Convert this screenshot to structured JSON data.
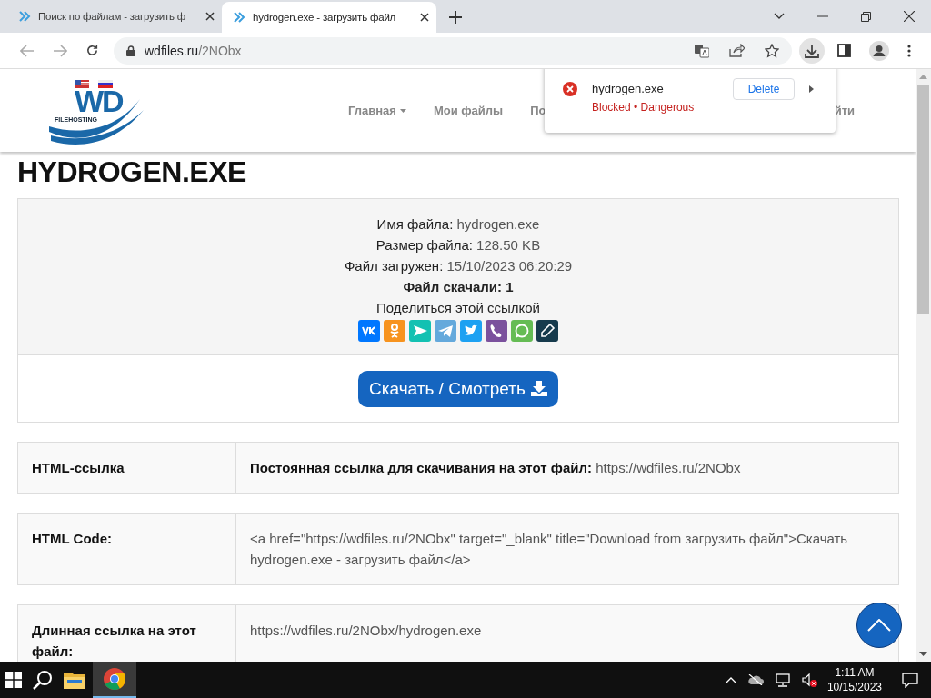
{
  "browser": {
    "tabs": [
      {
        "title": "Поиск по файлам - загрузить ф",
        "selected": false
      },
      {
        "title": "hydrogen.exe - загрузить файл",
        "selected": true
      }
    ],
    "url_host": "wdfiles.ru",
    "url_path": "/2NObx"
  },
  "download_popup": {
    "file": "hydrogen.exe",
    "status": "Blocked • Dangerous",
    "button": "Delete"
  },
  "site": {
    "logo": "WD",
    "logo_subtitle": "FILEHOSTING",
    "nav": [
      {
        "label": "Главная",
        "dropdown": true
      },
      {
        "label": "Мои файлы",
        "dropdown": false
      },
      {
        "label": "По",
        "dropdown": false
      },
      {
        "label": "йти",
        "dropdown": false
      }
    ]
  },
  "page": {
    "title": "HYDROGEN.EXE",
    "info": [
      {
        "kind": "pair",
        "label": "Имя файла:",
        "value": "hydrogen.exe"
      },
      {
        "kind": "pair",
        "label": "Размер файла:",
        "value": "128.50 KB"
      },
      {
        "kind": "pair",
        "label": "Файл загружен:",
        "value": "15/10/2023 06:20:29"
      },
      {
        "kind": "bold",
        "label": "Файл скачали: 1"
      },
      {
        "kind": "plain",
        "label": "Поделиться этой ссылкой"
      }
    ],
    "download_button": "Скачать / Смотреть",
    "rows": [
      {
        "label": "HTML-ссылка",
        "value_label": "Постоянная ссылка для скачивания на этот файл:",
        "value": "https://wdfiles.ru/2NObx"
      },
      {
        "label": "HTML Code:",
        "value": "<a href=\"https://wdfiles.ru/2NObx\" target=\"_blank\" title=\"Download from загрузить файл\">Скачать hydrogen.exe - загрузить файл</a>"
      },
      {
        "label": "Длинная ссылка на этот файл:",
        "value": "https://wdfiles.ru/2NObx/hydrogen.exe"
      }
    ]
  },
  "taskbar": {
    "time": "1:11 AM",
    "date": "10/15/2023"
  }
}
